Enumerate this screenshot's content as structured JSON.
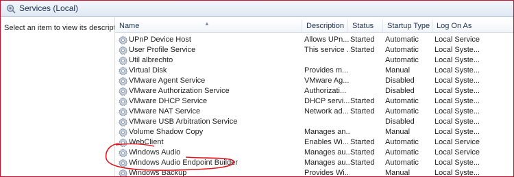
{
  "window": {
    "title": "Services (Local)"
  },
  "left_pane": {
    "description_prompt": "Select an item to view its description."
  },
  "columns": [
    "Name",
    "Description",
    "Status",
    "Startup Type",
    "Log On As"
  ],
  "services": [
    {
      "name": "UPnP Device Host",
      "description": "Allows UPn...",
      "status": "Started",
      "startup_type": "Automatic",
      "log_on_as": "Local Service"
    },
    {
      "name": "User Profile Service",
      "description": "This service ...",
      "status": "Started",
      "startup_type": "Automatic",
      "log_on_as": "Local Syste..."
    },
    {
      "name": "Util albrechto",
      "description": "",
      "status": "",
      "startup_type": "Automatic",
      "log_on_as": "Local Syste..."
    },
    {
      "name": "Virtual Disk",
      "description": "Provides m...",
      "status": "",
      "startup_type": "Manual",
      "log_on_as": "Local Syste..."
    },
    {
      "name": "VMware Agent Service",
      "description": "VMware Ag...",
      "status": "",
      "startup_type": "Disabled",
      "log_on_as": "Local Syste..."
    },
    {
      "name": "VMware Authorization Service",
      "description": "Authorizati...",
      "status": "",
      "startup_type": "Disabled",
      "log_on_as": "Local Syste..."
    },
    {
      "name": "VMware DHCP Service",
      "description": "DHCP servi...",
      "status": "Started",
      "startup_type": "Automatic",
      "log_on_as": "Local Syste..."
    },
    {
      "name": "VMware NAT Service",
      "description": "Network ad...",
      "status": "Started",
      "startup_type": "Automatic",
      "log_on_as": "Local Syste..."
    },
    {
      "name": "VMware USB Arbitration Service",
      "description": "",
      "status": "",
      "startup_type": "Disabled",
      "log_on_as": "Local Syste..."
    },
    {
      "name": "Volume Shadow Copy",
      "description": "Manages an...",
      "status": "",
      "startup_type": "Manual",
      "log_on_as": "Local Syste..."
    },
    {
      "name": "WebClient",
      "description": "Enables Wi...",
      "status": "Started",
      "startup_type": "Automatic",
      "log_on_as": "Local Service"
    },
    {
      "name": "Windows Audio",
      "description": "Manages au...",
      "status": "Started",
      "startup_type": "Automatic",
      "log_on_as": "Local Service"
    },
    {
      "name": "Windows Audio Endpoint Builder",
      "description": "Manages au...",
      "status": "Started",
      "startup_type": "Automatic",
      "log_on_as": "Local Syste..."
    },
    {
      "name": "Windows Backup",
      "description": "Provides Wi...",
      "status": "",
      "startup_type": "Manual",
      "log_on_as": "Local Syste..."
    }
  ],
  "colors": {
    "annotation": "#e0141e",
    "frame_border": "#c8102e",
    "header_text": "#1e3050"
  },
  "icons": {
    "title": "services-icon",
    "row": "gear-icon"
  }
}
